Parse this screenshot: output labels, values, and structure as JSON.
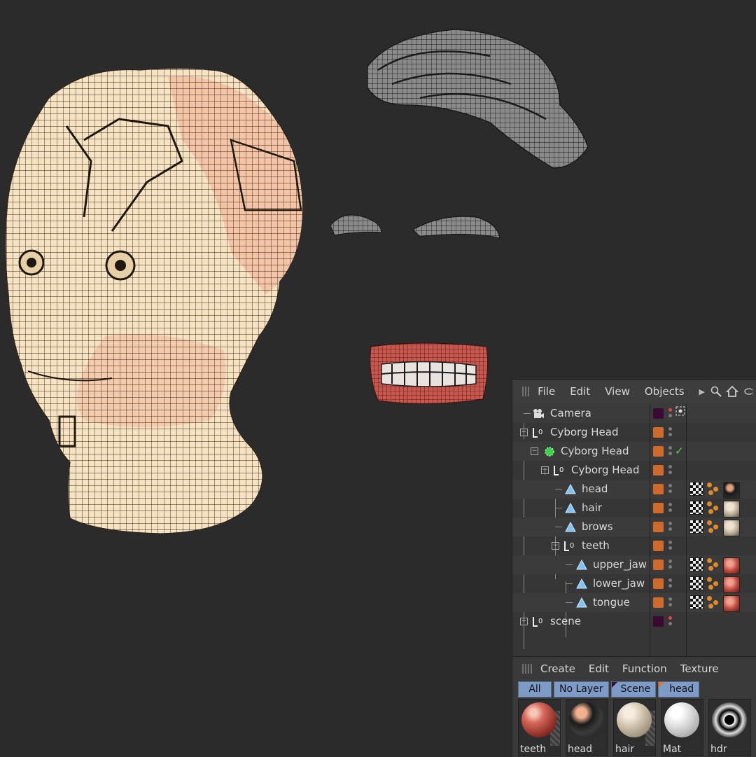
{
  "object_manager": {
    "menu": [
      "File",
      "Edit",
      "View",
      "Objects"
    ],
    "icons": [
      "grip-icon",
      "chevron-right-icon",
      "search-icon",
      "home-icon",
      "link-icon"
    ],
    "objects": [
      {
        "name": "Camera",
        "type": "camera"
      },
      {
        "name": "Cyborg Head",
        "type": "null"
      },
      {
        "name": "Cyborg Head",
        "type": "generator"
      },
      {
        "name": "Cyborg Head",
        "type": "null"
      },
      {
        "name": "head",
        "type": "polygon"
      },
      {
        "name": "hair",
        "type": "polygon"
      },
      {
        "name": "brows",
        "type": "polygon"
      },
      {
        "name": "teeth",
        "type": "null"
      },
      {
        "name": "upper_jaw",
        "type": "polygon"
      },
      {
        "name": "lower_jaw",
        "type": "polygon"
      },
      {
        "name": "tongue",
        "type": "polygon"
      },
      {
        "name": "scene",
        "type": "null"
      }
    ]
  },
  "material_manager": {
    "menu": [
      "Create",
      "Edit",
      "Function",
      "Texture"
    ],
    "filters": [
      "All",
      "No Layer",
      "Scene",
      "head"
    ],
    "materials": [
      "teeth",
      "head",
      "hair",
      "Mat",
      "hdr"
    ]
  },
  "colors": {
    "background": "#2b2b2b",
    "layer_orange": "#d06a2a",
    "layer_purple": "#3a0a35",
    "filter_blue": "#7e9bc8",
    "head_wire": "#f5d9b0"
  }
}
